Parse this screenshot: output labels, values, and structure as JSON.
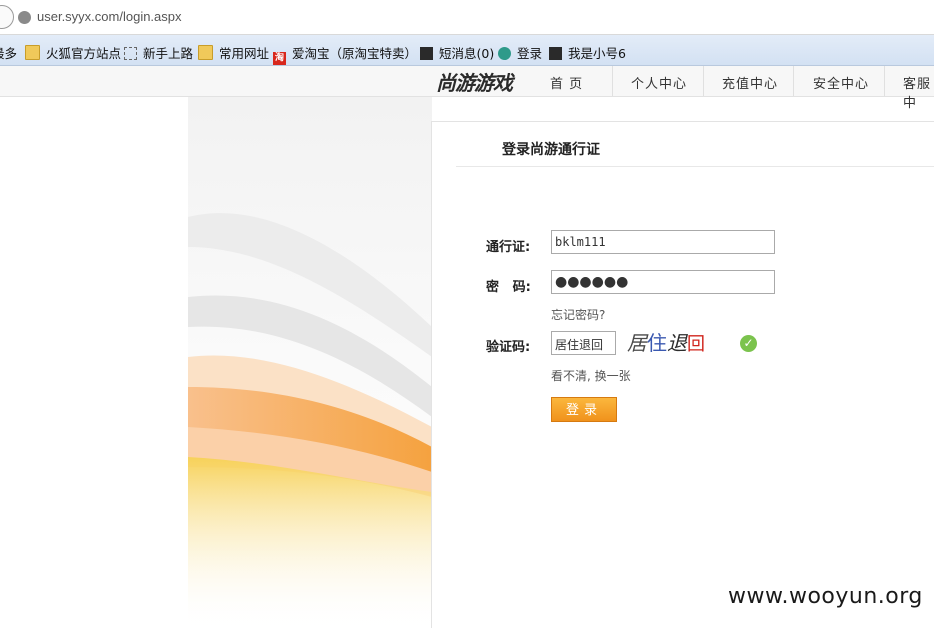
{
  "browser": {
    "url": "user.syyx.com/login.aspx"
  },
  "bookmarks": {
    "items": [
      {
        "label": "最多",
        "icon": "none"
      },
      {
        "label": "火狐官方站点",
        "icon": "folder-icon"
      },
      {
        "label": "新手上路",
        "icon": "dashed-page-icon"
      },
      {
        "label": "常用网址",
        "icon": "folder-icon"
      },
      {
        "label": "爱淘宝（原淘宝特卖）",
        "icon": "taobao-icon"
      },
      {
        "label": "短消息(0)",
        "icon": "message-icon"
      },
      {
        "label": "登录",
        "icon": "globe-icon"
      },
      {
        "label": "我是小号6",
        "icon": "message-icon"
      }
    ]
  },
  "site": {
    "logo": "尚游游戏",
    "nav": [
      "首 页",
      "个人中心",
      "充值中心",
      "安全中心",
      "客服中"
    ]
  },
  "form": {
    "title": "登录尚游通行证",
    "account_label": "通行证:",
    "account_value": "bklm111",
    "password_label": "密   码:",
    "password_value": "●●●●●●",
    "forgot": "忘记密码?",
    "captcha_label": "验证码:",
    "captcha_value": "居住退回",
    "captcha_image_text": [
      "居",
      "住",
      "退",
      "回"
    ],
    "refresh_captcha": "看不清, 换一张",
    "login_button": "登录"
  },
  "watermark": "www.wooyun.org",
  "colors": {
    "button_orange": "#f5a52a",
    "check_green": "#7bc34d",
    "captcha_colors": [
      "#4a4a4a",
      "#3a58b0",
      "#2c2c2c",
      "#d0241c"
    ]
  }
}
